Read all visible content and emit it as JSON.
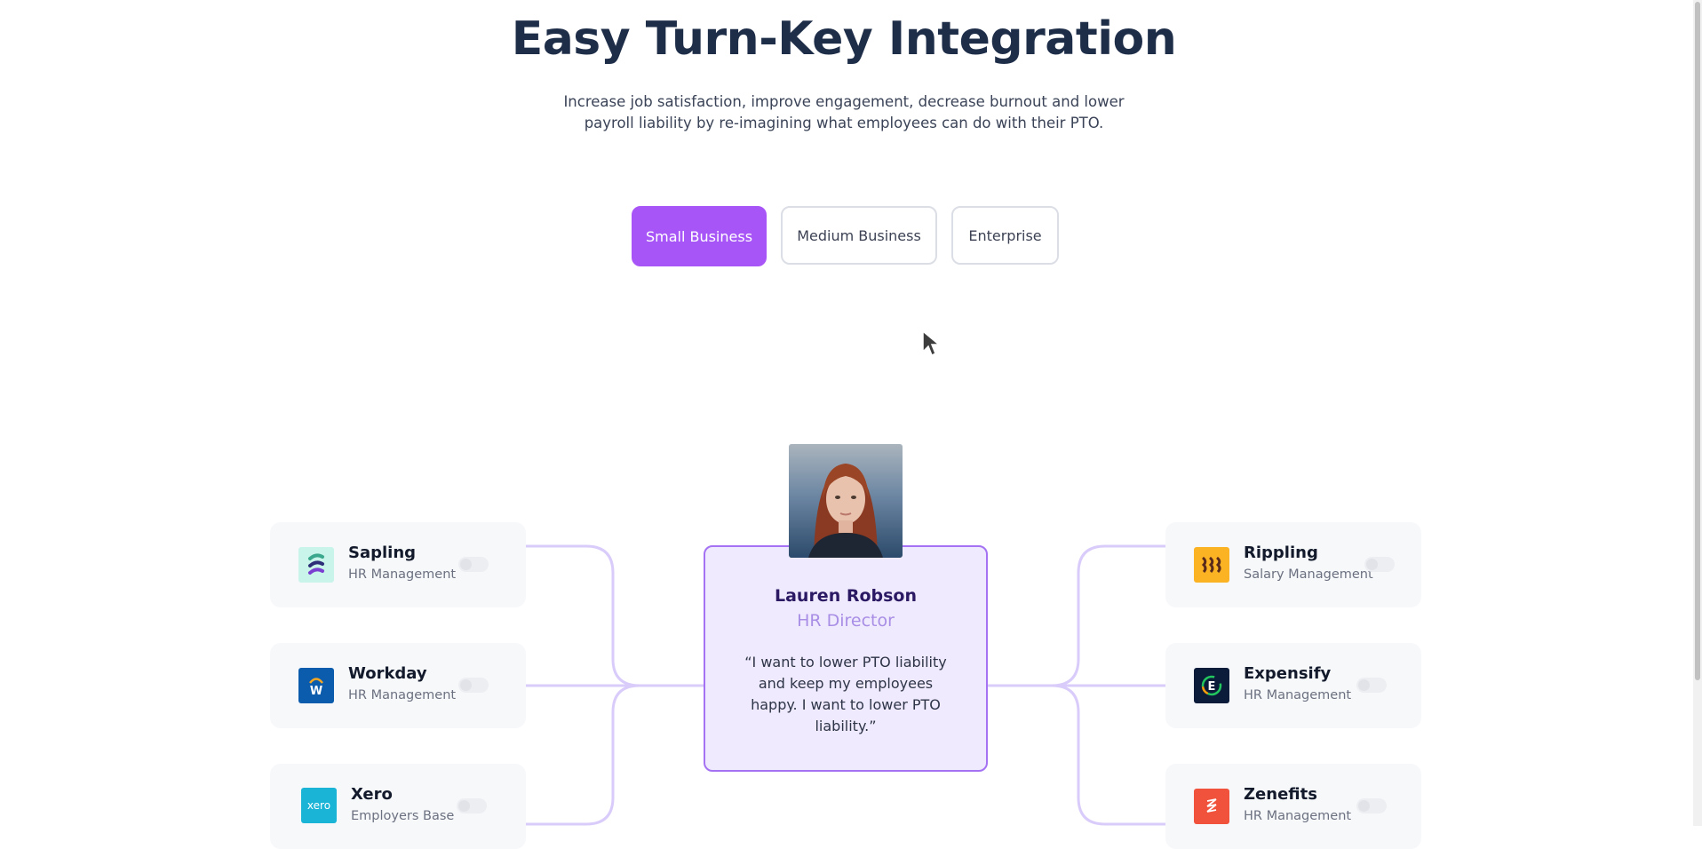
{
  "hero": {
    "title": "Easy Turn-Key Integration",
    "subtitle": "Increase job satisfaction, improve engagement, decrease burnout and lower payroll liability by re-imagining what employees can do with their PTO."
  },
  "tabs": [
    {
      "label": "Small Business",
      "active": true
    },
    {
      "label": "Medium Business",
      "active": false
    },
    {
      "label": "Enterprise",
      "active": false
    }
  ],
  "integrations_left": [
    {
      "name": "Sapling",
      "category": "HR Management",
      "icon": "sapling-logo-icon",
      "enabled": false
    },
    {
      "name": "Workday",
      "category": "HR Management",
      "icon": "workday-logo-icon",
      "enabled": false
    },
    {
      "name": "Xero",
      "category": "Employers Base",
      "icon": "xero-logo-icon",
      "enabled": false
    }
  ],
  "integrations_right": [
    {
      "name": "Rippling",
      "category": "Salary Management",
      "icon": "rippling-logo-icon",
      "enabled": false
    },
    {
      "name": "Expensify",
      "category": "HR Management",
      "icon": "expensify-logo-icon",
      "enabled": false
    },
    {
      "name": "Zenefits",
      "category": "HR Management",
      "icon": "zenefits-logo-icon",
      "enabled": false
    }
  ],
  "logos": {
    "xero_text": "xero",
    "workday_text": "W",
    "expensify_text": "E"
  },
  "persona": {
    "name": "Lauren Robson",
    "role": "HR Director",
    "quote": "“I want to lower PTO liability and keep my employees happy. I want to lower PTO liability.”"
  },
  "colors": {
    "accent": "#a855f7",
    "connector": "#d9ccfa",
    "persona_border": "#a472f2",
    "persona_bg": "#efeafd"
  }
}
